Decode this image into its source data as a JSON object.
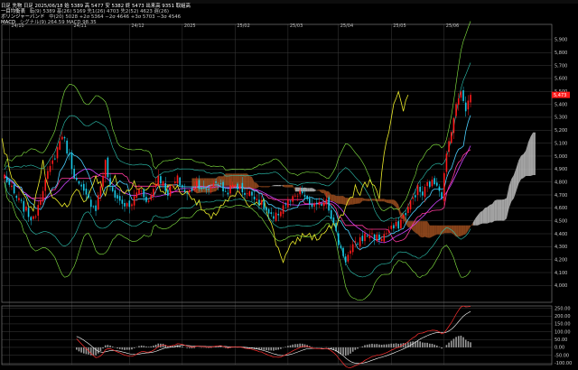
{
  "header": {
    "line1": "日足 先物  日足 2025/06/18 始 5389 高 5477 安 5382 終 5473 出来高 9351 取組高",
    "line2_label": "一目均衡表",
    "line2": "転(9) 5389  基(26) 5169  先1(26) 4703  先2(52) 4623  遅(26)",
    "line3_label": "ボリンジャーバンド",
    "line3": "中(20) 5028  +2σ 5364  −2σ 4646  +3σ 5703  −3σ 4546",
    "line4_label": "MACD",
    "line4": "シグナル(9) 264.59  MACD 98.35"
  },
  "colors": {
    "background": "#000000",
    "grid": "#3c3c3c",
    "candle_up": "#ff1a1a",
    "candle_down": "#19c8e6",
    "tenkan": "#4ad0ff",
    "kijun": "#ff3a9c",
    "chikou": "#ecec2a",
    "kumo_bull": "#bebebe",
    "kumo_bear": "#9c4e1e",
    "bb_mid": "#cc44ff",
    "bb_band": "#2ec7b4",
    "bb_3sigma": "#88ee44",
    "macd": "#ff3030",
    "signal": "#ffffff",
    "histogram": "#9a9a9a"
  },
  "chart_data": [
    {
      "type": "candlestick",
      "title": "",
      "x_labels": [
        "24/10",
        "24/11",
        "24/12",
        "2025",
        "25/02",
        "25/03",
        "25/04",
        "25/05",
        "25/06"
      ],
      "x_label_index": [
        2,
        28,
        52,
        74,
        96,
        118,
        139,
        161,
        183
      ],
      "y_ticks": [
        4000,
        4100,
        4200,
        4300,
        4400,
        4500,
        4600,
        4700,
        4800,
        4900,
        5000,
        5100,
        5200,
        5300,
        5400,
        5500,
        5600,
        5700,
        5800,
        5900
      ],
      "ylim": [
        3870,
        5990
      ],
      "last_price": 5473,
      "close_anchors": [
        [
          0,
          4850
        ],
        [
          4,
          4700
        ],
        [
          8,
          4600
        ],
        [
          12,
          4500
        ],
        [
          16,
          4760
        ],
        [
          20,
          4950
        ],
        [
          24,
          5170
        ],
        [
          26,
          5050
        ],
        [
          30,
          4800
        ],
        [
          34,
          4680
        ],
        [
          38,
          4600
        ],
        [
          42,
          4950
        ],
        [
          44,
          4750
        ],
        [
          48,
          4650
        ],
        [
          52,
          4600
        ],
        [
          56,
          4750
        ],
        [
          60,
          4650
        ],
        [
          64,
          4850
        ],
        [
          68,
          4720
        ],
        [
          72,
          4820
        ],
        [
          76,
          4700
        ],
        [
          80,
          4800
        ],
        [
          84,
          4720
        ],
        [
          88,
          4810
        ],
        [
          92,
          4720
        ],
        [
          96,
          4780
        ],
        [
          100,
          4720
        ],
        [
          104,
          4700
        ],
        [
          108,
          4600
        ],
        [
          112,
          4500
        ],
        [
          116,
          4620
        ],
        [
          120,
          4660
        ],
        [
          124,
          4720
        ],
        [
          126,
          4640
        ],
        [
          130,
          4600
        ],
        [
          134,
          4680
        ],
        [
          136,
          4540
        ],
        [
          139,
          4330
        ],
        [
          142,
          4200
        ],
        [
          145,
          4290
        ],
        [
          148,
          4360
        ],
        [
          152,
          4400
        ],
        [
          156,
          4360
        ],
        [
          160,
          4420
        ],
        [
          164,
          4470
        ],
        [
          168,
          4600
        ],
        [
          172,
          4750
        ],
        [
          174,
          4700
        ],
        [
          176,
          4780
        ],
        [
          180,
          4800
        ],
        [
          182,
          4700
        ],
        [
          184,
          5000
        ],
        [
          186,
          5220
        ],
        [
          188,
          5380
        ],
        [
          190,
          5520
        ],
        [
          192,
          5370
        ],
        [
          194,
          5473
        ]
      ],
      "n_candles": 195,
      "chikou_extends_to": 168,
      "kumo_extends_to": 220,
      "series": [
        {
          "name": "転(9)",
          "kind": "tenkan"
        },
        {
          "name": "基(26)",
          "kind": "kijun"
        },
        {
          "name": "遅(26)",
          "kind": "chikou"
        },
        {
          "name": "中(20)",
          "kind": "bb_mid"
        },
        {
          "name": "+2σ",
          "kind": "bb_band"
        },
        {
          "name": "−2σ",
          "kind": "bb_band"
        },
        {
          "name": "+3σ",
          "kind": "bb_3sigma"
        },
        {
          "name": "−3σ",
          "kind": "bb_3sigma"
        }
      ]
    },
    {
      "type": "line",
      "title": "",
      "y_ticks": [
        -100,
        -50,
        0,
        50,
        100,
        150,
        200,
        250
      ],
      "y_tick_labels": [
        "-100.00",
        "-50.00",
        "0.00",
        "50.00",
        "100.00",
        "150.00",
        "200.00",
        "250.00"
      ],
      "ylim": [
        -110,
        265
      ],
      "macd_last": 98.35,
      "signal_last": 264.59,
      "series": [
        {
          "name": "MACD",
          "kind": "macd"
        },
        {
          "name": "シグナル(9)",
          "kind": "signal"
        }
      ]
    }
  ]
}
